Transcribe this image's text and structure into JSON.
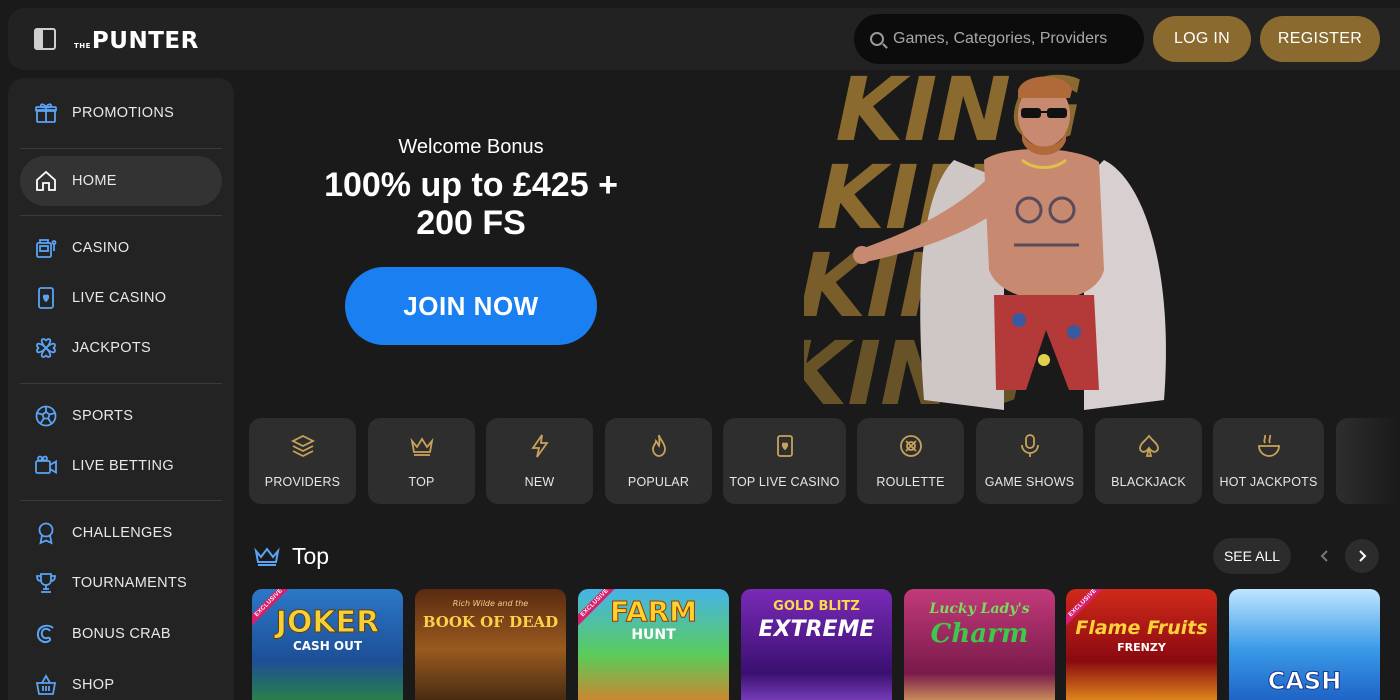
{
  "header": {
    "logo_small": "THE",
    "logo_main": "PUNTER",
    "search_placeholder": "Games, Categories, Providers",
    "login_label": "LOG IN",
    "register_label": "REGISTER"
  },
  "sidebar": {
    "items": [
      {
        "label": "PROMOTIONS",
        "icon": "gift-icon"
      },
      {
        "label": "HOME",
        "icon": "home-icon",
        "active": true
      },
      {
        "label": "CASINO",
        "icon": "slot-machine-icon"
      },
      {
        "label": "LIVE CASINO",
        "icon": "playing-card-icon"
      },
      {
        "label": "JACKPOTS",
        "icon": "clover-icon"
      },
      {
        "label": "SPORTS",
        "icon": "soccer-ball-icon"
      },
      {
        "label": "LIVE BETTING",
        "icon": "video-camera-icon"
      },
      {
        "label": "CHALLENGES",
        "icon": "medal-icon"
      },
      {
        "label": "TOURNAMENTS",
        "icon": "trophy-icon"
      },
      {
        "label": "BONUS CRAB",
        "icon": "crab-claw-icon"
      },
      {
        "label": "SHOP",
        "icon": "basket-icon"
      }
    ]
  },
  "hero": {
    "subtitle": "Welcome Bonus",
    "title_line1": "100% up to £425 +",
    "title_line2": "200 FS",
    "cta": "JOIN NOW",
    "art_text": "KING"
  },
  "categories": [
    {
      "label": "PROVIDERS",
      "icon": "layers-icon"
    },
    {
      "label": "TOP",
      "icon": "crown-icon"
    },
    {
      "label": "NEW",
      "icon": "lightning-icon"
    },
    {
      "label": "POPULAR",
      "icon": "flame-icon"
    },
    {
      "label": "TOP LIVE CASINO",
      "icon": "playing-card-icon"
    },
    {
      "label": "ROULETTE",
      "icon": "roulette-icon"
    },
    {
      "label": "GAME SHOWS",
      "icon": "microphone-icon"
    },
    {
      "label": "BLACKJACK",
      "icon": "spade-icon"
    },
    {
      "label": "HOT JACKPOTS",
      "icon": "hot-pot-icon"
    }
  ],
  "section": {
    "title": "Top",
    "see_all": "SEE ALL"
  },
  "games": [
    {
      "title": "JOKER",
      "sub": "CASH OUT",
      "badge": "EXCLUSIVE",
      "bg": "#1f5fb0",
      "color": "#f3d13a"
    },
    {
      "title": "BOOK OF DEAD",
      "sub": "Rich Wilde and the",
      "badge": "",
      "bg": "#8a4a1a",
      "color": "#ffcf4a"
    },
    {
      "title": "FARM",
      "sub": "HUNT",
      "badge": "EXCLUSIVE",
      "bg": "#3aa2d6",
      "color": "#ffd22e"
    },
    {
      "title": "EXTREME",
      "sub": "GOLD BLITZ",
      "badge": "",
      "bg": "#5b1fa0",
      "color": "#ffffff"
    },
    {
      "title": "Charm",
      "sub": "Lucky Lady's",
      "badge": "",
      "bg": "#a3285e",
      "color": "#3ec84a"
    },
    {
      "title": "Flame Fruits",
      "sub": "FRENZY",
      "badge": "EXCLUSIVE",
      "bg": "#b01a1a",
      "color": "#ffd23a"
    },
    {
      "title": "CASH",
      "sub": "",
      "badge": "",
      "bg": "#3aa0e8",
      "color": "#ffffff"
    }
  ]
}
